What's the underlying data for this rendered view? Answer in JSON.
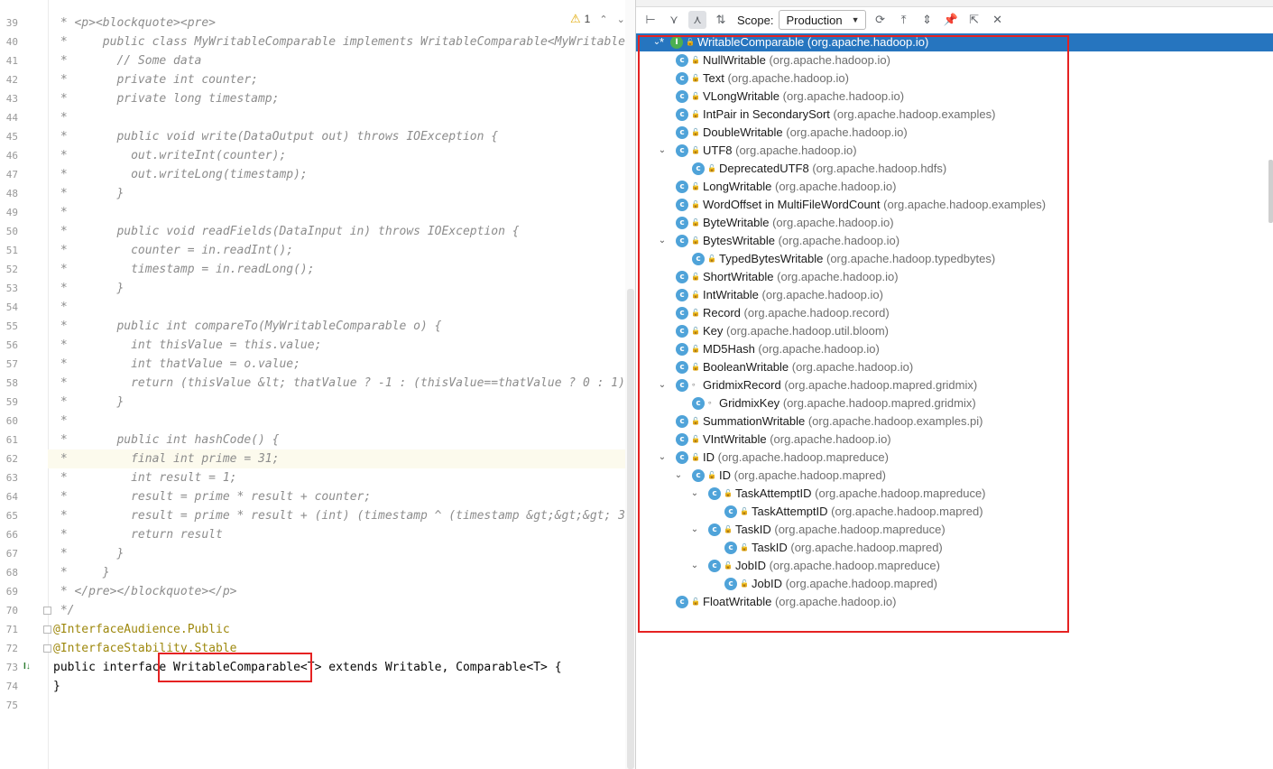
{
  "editor": {
    "inspection": {
      "warning_icon": "warning-icon",
      "count": "1"
    },
    "lines": [
      {
        "n": "39",
        "kind": "comment",
        "text": " * <p><blockquote><pre>"
      },
      {
        "n": "40",
        "kind": "comment",
        "text": " *     public class MyWritableComparable implements WritableComparable<MyWritable"
      },
      {
        "n": "41",
        "kind": "comment",
        "text": " *       // Some data"
      },
      {
        "n": "42",
        "kind": "comment",
        "text": " *       private int counter;"
      },
      {
        "n": "43",
        "kind": "comment",
        "text": " *       private long timestamp;"
      },
      {
        "n": "44",
        "kind": "comment",
        "text": " *"
      },
      {
        "n": "45",
        "kind": "comment",
        "text": " *       public void write(DataOutput out) throws IOException {"
      },
      {
        "n": "46",
        "kind": "comment",
        "text": " *         out.writeInt(counter);"
      },
      {
        "n": "47",
        "kind": "comment",
        "text": " *         out.writeLong(timestamp);"
      },
      {
        "n": "48",
        "kind": "comment",
        "text": " *       }"
      },
      {
        "n": "49",
        "kind": "comment",
        "text": " *"
      },
      {
        "n": "50",
        "kind": "comment",
        "text": " *       public void readFields(DataInput in) throws IOException {"
      },
      {
        "n": "51",
        "kind": "comment",
        "text": " *         counter = in.readInt();"
      },
      {
        "n": "52",
        "kind": "comment",
        "text": " *         timestamp = in.readLong();"
      },
      {
        "n": "53",
        "kind": "comment",
        "text": " *       }"
      },
      {
        "n": "54",
        "kind": "comment",
        "text": " *"
      },
      {
        "n": "55",
        "kind": "comment",
        "text": " *       public int compareTo(MyWritableComparable o) {"
      },
      {
        "n": "56",
        "kind": "comment",
        "text": " *         int thisValue = this.value;"
      },
      {
        "n": "57",
        "kind": "comment",
        "text": " *         int thatValue = o.value;"
      },
      {
        "n": "58",
        "kind": "comment",
        "text": " *         return (thisValue &lt; thatValue ? -1 : (thisValue==thatValue ? 0 : 1)"
      },
      {
        "n": "59",
        "kind": "comment",
        "text": " *       }"
      },
      {
        "n": "60",
        "kind": "comment",
        "text": " *"
      },
      {
        "n": "61",
        "kind": "comment",
        "text": " *       public int hashCode() {"
      },
      {
        "n": "62",
        "kind": "comment",
        "text": " *         final int prime = 31;"
      },
      {
        "n": "63",
        "kind": "comment",
        "text": " *         int result = 1;"
      },
      {
        "n": "64",
        "kind": "comment",
        "text": " *         result = prime * result + counter;"
      },
      {
        "n": "65",
        "kind": "comment",
        "text": " *         result = prime * result + (int) (timestamp ^ (timestamp &gt;&gt;&gt; 3"
      },
      {
        "n": "66",
        "kind": "comment",
        "text": " *         return result"
      },
      {
        "n": "67",
        "kind": "comment",
        "text": " *       }"
      },
      {
        "n": "68",
        "kind": "comment",
        "text": " *     }"
      },
      {
        "n": "69",
        "kind": "comment",
        "text": " * </pre></blockquote></p>"
      },
      {
        "n": "70",
        "kind": "comment",
        "text": " */"
      },
      {
        "n": "71",
        "kind": "anno",
        "text": "@InterfaceAudience.Public"
      },
      {
        "n": "72",
        "kind": "anno",
        "text": "@InterfaceStability.Stable"
      },
      {
        "n": "73",
        "kind": "decl",
        "text": "public interface WritableComparable<T> extends Writable, Comparable<T> {"
      },
      {
        "n": "74",
        "kind": "plain",
        "text": "}"
      },
      {
        "n": "75",
        "kind": "plain",
        "text": ""
      }
    ]
  },
  "panel": {
    "toolbar": {
      "scope_label": "Scope:",
      "scope_value": "Production",
      "icons": [
        "subtypes-hierarchy-icon",
        "supertypes-hierarchy-icon",
        "class-hierarchy-icon",
        "sort-alphabetically-icon"
      ],
      "right_icons": [
        "refresh-icon",
        "expand-all-icon",
        "collapse-all-icon",
        "pin-icon",
        "export-icon",
        "close-icon"
      ]
    },
    "tree": [
      {
        "depth": 0,
        "name": "WritableComparable",
        "pkg": "(org.apache.hadoop.io)",
        "type": "interface",
        "expanded": true,
        "selected": true,
        "star": true
      },
      {
        "depth": 1,
        "name": "NullWritable",
        "pkg": "(org.apache.hadoop.io)",
        "type": "class"
      },
      {
        "depth": 1,
        "name": "Text",
        "pkg": "(org.apache.hadoop.io)",
        "type": "class"
      },
      {
        "depth": 1,
        "name": "VLongWritable",
        "pkg": "(org.apache.hadoop.io)",
        "type": "class"
      },
      {
        "depth": 1,
        "name": "IntPair in SecondarySort",
        "pkg": "(org.apache.hadoop.examples)",
        "type": "class"
      },
      {
        "depth": 1,
        "name": "DoubleWritable",
        "pkg": "(org.apache.hadoop.io)",
        "type": "class"
      },
      {
        "depth": 1,
        "name": "UTF8",
        "pkg": "(org.apache.hadoop.io)",
        "type": "class",
        "expanded": true
      },
      {
        "depth": 2,
        "name": "DeprecatedUTF8",
        "pkg": "(org.apache.hadoop.hdfs)",
        "type": "class"
      },
      {
        "depth": 1,
        "name": "LongWritable",
        "pkg": "(org.apache.hadoop.io)",
        "type": "class"
      },
      {
        "depth": 1,
        "name": "WordOffset in MultiFileWordCount",
        "pkg": "(org.apache.hadoop.examples)",
        "type": "class"
      },
      {
        "depth": 1,
        "name": "ByteWritable",
        "pkg": "(org.apache.hadoop.io)",
        "type": "class"
      },
      {
        "depth": 1,
        "name": "BytesWritable",
        "pkg": "(org.apache.hadoop.io)",
        "type": "class",
        "expanded": true
      },
      {
        "depth": 2,
        "name": "TypedBytesWritable",
        "pkg": "(org.apache.hadoop.typedbytes)",
        "type": "class"
      },
      {
        "depth": 1,
        "name": "ShortWritable",
        "pkg": "(org.apache.hadoop.io)",
        "type": "class"
      },
      {
        "depth": 1,
        "name": "IntWritable",
        "pkg": "(org.apache.hadoop.io)",
        "type": "class"
      },
      {
        "depth": 1,
        "name": "Record",
        "pkg": "(org.apache.hadoop.record)",
        "type": "class"
      },
      {
        "depth": 1,
        "name": "Key",
        "pkg": "(org.apache.hadoop.util.bloom)",
        "type": "class"
      },
      {
        "depth": 1,
        "name": "MD5Hash",
        "pkg": "(org.apache.hadoop.io)",
        "type": "class"
      },
      {
        "depth": 1,
        "name": "BooleanWritable",
        "pkg": "(org.apache.hadoop.io)",
        "type": "class"
      },
      {
        "depth": 1,
        "name": "GridmixRecord",
        "pkg": "(org.apache.hadoop.mapred.gridmix)",
        "type": "class",
        "expanded": true,
        "dot": true
      },
      {
        "depth": 2,
        "name": "GridmixKey",
        "pkg": "(org.apache.hadoop.mapred.gridmix)",
        "type": "class",
        "dot": true
      },
      {
        "depth": 1,
        "name": "SummationWritable",
        "pkg": "(org.apache.hadoop.examples.pi)",
        "type": "class"
      },
      {
        "depth": 1,
        "name": "VIntWritable",
        "pkg": "(org.apache.hadoop.io)",
        "type": "class"
      },
      {
        "depth": 1,
        "name": "ID",
        "pkg": "(org.apache.hadoop.mapreduce)",
        "type": "class",
        "expanded": true
      },
      {
        "depth": 2,
        "name": "ID",
        "pkg": "(org.apache.hadoop.mapred)",
        "type": "class",
        "expanded": true
      },
      {
        "depth": 3,
        "name": "TaskAttemptID",
        "pkg": "(org.apache.hadoop.mapreduce)",
        "type": "class",
        "expanded": true
      },
      {
        "depth": 4,
        "name": "TaskAttemptID",
        "pkg": "(org.apache.hadoop.mapred)",
        "type": "class"
      },
      {
        "depth": 3,
        "name": "TaskID",
        "pkg": "(org.apache.hadoop.mapreduce)",
        "type": "class",
        "expanded": true
      },
      {
        "depth": 4,
        "name": "TaskID",
        "pkg": "(org.apache.hadoop.mapred)",
        "type": "class"
      },
      {
        "depth": 3,
        "name": "JobID",
        "pkg": "(org.apache.hadoop.mapreduce)",
        "type": "class",
        "expanded": true
      },
      {
        "depth": 4,
        "name": "JobID",
        "pkg": "(org.apache.hadoop.mapred)",
        "type": "class"
      },
      {
        "depth": 1,
        "name": "FloatWritable",
        "pkg": "(org.apache.hadoop.io)",
        "type": "class"
      }
    ]
  }
}
